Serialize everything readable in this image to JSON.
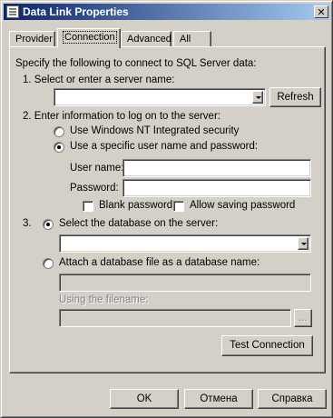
{
  "window": {
    "title": "Data Link Properties",
    "close_glyph": "✕"
  },
  "tabs": [
    {
      "label": "Provider",
      "active": false
    },
    {
      "label": "Connection",
      "active": true
    },
    {
      "label": "Advanced",
      "active": false
    },
    {
      "label": "All",
      "active": false
    }
  ],
  "connection": {
    "intro": "Specify the following to connect to SQL Server data:",
    "step1_label": "1. Select or enter a server name:",
    "server_value": "",
    "refresh_button": "Refresh",
    "step2_label": "2. Enter information to log on to the server:",
    "opt_nt_security": "Use Windows NT Integrated security",
    "opt_specific_user": "Use a specific user name and password:",
    "username_label": "User name:",
    "username_value": "",
    "password_label": "Password:",
    "password_value": "",
    "blank_password": "Blank password",
    "allow_saving": "Allow saving password",
    "step3_label": "3.",
    "opt_select_db": "Select the database on the server:",
    "database_value": "",
    "opt_attach_db": "Attach a database file as a database name:",
    "attach_value": "",
    "filename_label": "Using the filename:",
    "filename_value": "",
    "browse_button": "...",
    "test_button": "Test Connection"
  },
  "footer": {
    "ok": "OK",
    "cancel": "Отмена",
    "help": "Справка"
  }
}
